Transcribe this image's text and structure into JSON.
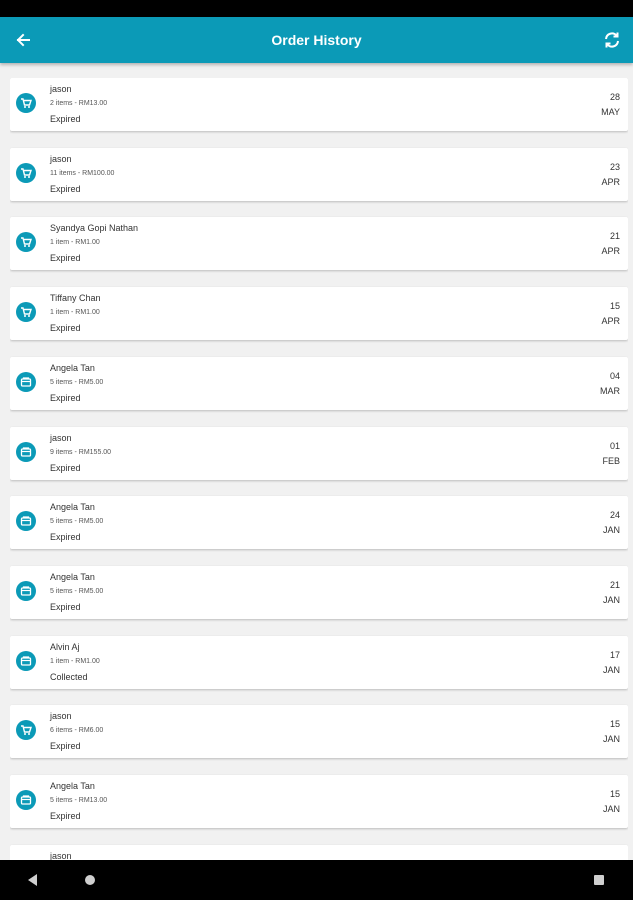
{
  "header": {
    "title": "Order History",
    "back_icon": "arrow-left-icon",
    "refresh_icon": "refresh-icon"
  },
  "colors": {
    "accent": "#0b9ab7"
  },
  "orders": [
    {
      "name": "jason",
      "meta": "2 items - RM13.00",
      "status": "Expired",
      "day": "28",
      "month": "MAY",
      "icon": "cart-icon"
    },
    {
      "name": "jason",
      "meta": "11 items - RM100.00",
      "status": "Expired",
      "day": "23",
      "month": "APR",
      "icon": "cart-icon"
    },
    {
      "name": "Syandya Gopi Nathan",
      "meta": "1 item - RM1.00",
      "status": "Expired",
      "day": "21",
      "month": "APR",
      "icon": "cart-icon"
    },
    {
      "name": "Tiffany Chan",
      "meta": "1 item - RM1.00",
      "status": "Expired",
      "day": "15",
      "month": "APR",
      "icon": "cart-icon"
    },
    {
      "name": "Angela Tan",
      "meta": "5 items - RM5.00",
      "status": "Expired",
      "day": "04",
      "month": "MAR",
      "icon": "store-icon"
    },
    {
      "name": "jason",
      "meta": "9 items - RM155.00",
      "status": "Expired",
      "day": "01",
      "month": "FEB",
      "icon": "store-icon"
    },
    {
      "name": "Angela Tan",
      "meta": "5 items - RM5.00",
      "status": "Expired",
      "day": "24",
      "month": "JAN",
      "icon": "store-icon"
    },
    {
      "name": "Angela Tan",
      "meta": "5 items - RM5.00",
      "status": "Expired",
      "day": "21",
      "month": "JAN",
      "icon": "store-icon"
    },
    {
      "name": "Alvin Aj",
      "meta": "1 item - RM1.00",
      "status": "Collected",
      "day": "17",
      "month": "JAN",
      "icon": "store-icon"
    },
    {
      "name": "jason",
      "meta": "6 items - RM6.00",
      "status": "Expired",
      "day": "15",
      "month": "JAN",
      "icon": "cart-icon"
    },
    {
      "name": "Angela Tan",
      "meta": "5 items - RM13.00",
      "status": "Expired",
      "day": "15",
      "month": "JAN",
      "icon": "store-icon"
    },
    {
      "name": "jason",
      "meta": "",
      "status": "",
      "day": "",
      "month": "",
      "icon": "cart-icon"
    }
  ]
}
